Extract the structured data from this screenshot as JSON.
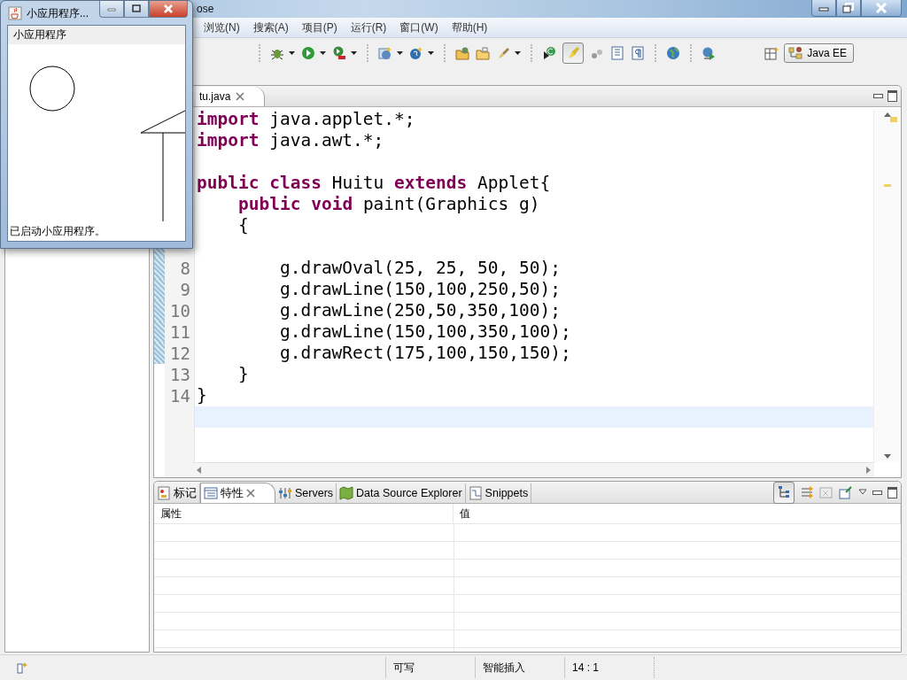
{
  "ide_window": {
    "title": "ose"
  },
  "menu": [
    "浏览(N)",
    "搜索(A)",
    "项目(P)",
    "运行(R)",
    "窗口(W)",
    "帮助(H)"
  ],
  "toolbar": {
    "perspective": "Java EE"
  },
  "editor": {
    "tab": {
      "label": "tu.java",
      "selected": true
    },
    "lines": [
      {
        "code": "**import** java.applet.*;",
        "current": false
      },
      {
        "code": "**import** java.awt.*;",
        "current": false
      },
      {
        "current": false
      },
      {
        "code": "**public** **class** Huitu **extends** Applet{",
        "current": false
      },
      {
        "code": "    **public** **void** paint(Graphics g)",
        "current": false
      },
      {
        "code": "    {",
        "current": false
      },
      {
        "changed": true,
        "current": false
      },
      {
        "number": "8",
        "code": "        g.drawOval(25, 25, 50, 50);",
        "changed": true,
        "current": false
      },
      {
        "number": "9",
        "code": "        g.drawLine(150,100,250,50);",
        "changed": true,
        "current": false
      },
      {
        "number": "10",
        "code": "        g.drawLine(250,50,350,100);",
        "changed": true,
        "current": false
      },
      {
        "number": "11",
        "code": "        g.drawLine(150,100,350,100);",
        "changed": true,
        "current": false
      },
      {
        "number": "12",
        "code": "        g.drawRect(175,100,150,150);",
        "changed": true,
        "current": false
      },
      {
        "number": "13",
        "code": "    }",
        "changed": false,
        "current": false
      },
      {
        "number": "14",
        "code": "}",
        "changed": false,
        "current": false
      },
      {
        "changed": false,
        "current": true
      }
    ]
  },
  "bottom_panel": {
    "tabs": [
      {
        "label": "标记",
        "selected": false,
        "closable": false
      },
      {
        "label": "特性",
        "selected": true,
        "closable": true
      },
      {
        "label": "Servers",
        "selected": false,
        "closable": false
      },
      {
        "label": "Data Source Explorer",
        "selected": false,
        "closable": false
      },
      {
        "label": "Snippets",
        "selected": false,
        "closable": false
      }
    ],
    "columns": [
      "属性",
      "值"
    ]
  },
  "status_bar": {
    "cells": [
      "可写",
      "智能插入",
      "14 : 1"
    ]
  },
  "applet_window": {
    "title": "小应用程序...",
    "label": "小应用程序",
    "status": "已启动小应用程序。"
  }
}
